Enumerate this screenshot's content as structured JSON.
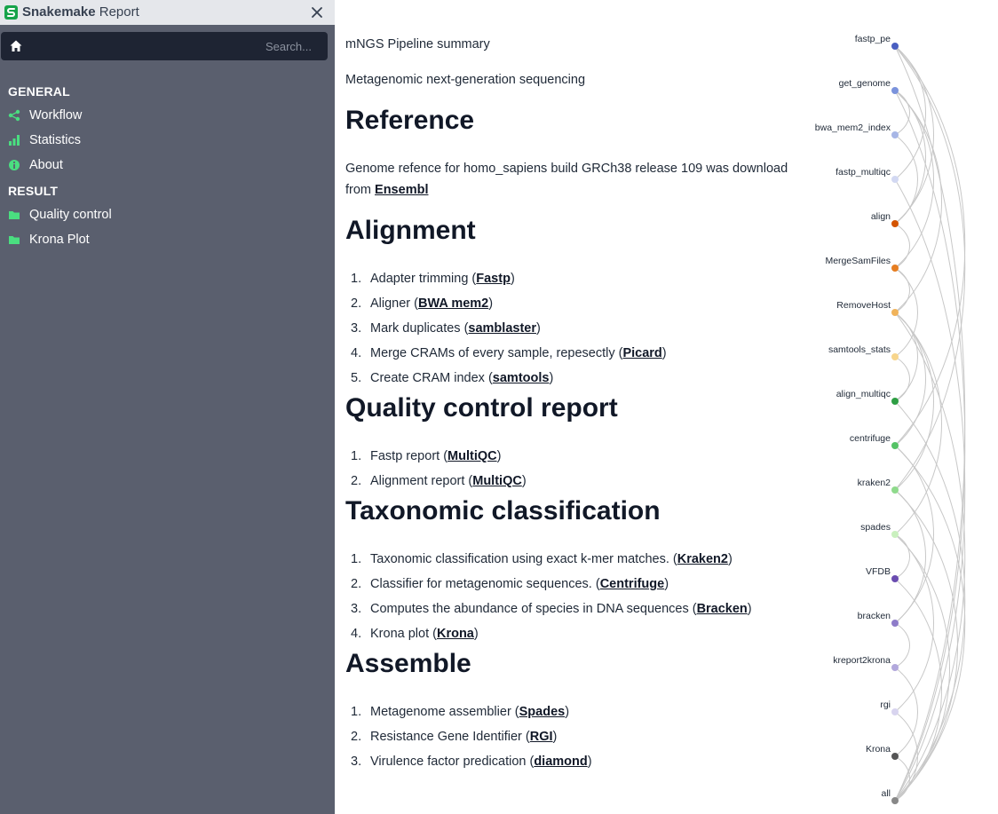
{
  "app": {
    "brand_bold": "Snakemake",
    "brand_rest": " Report"
  },
  "search": {
    "placeholder": "Search..."
  },
  "sidebar": {
    "general_heading": "GENERAL",
    "general_items": [
      {
        "label": "Workflow",
        "icon": "share-icon"
      },
      {
        "label": "Statistics",
        "icon": "bar-chart-icon"
      },
      {
        "label": "About",
        "icon": "info-icon"
      }
    ],
    "result_heading": "RESULT",
    "result_items": [
      {
        "label": "Quality control",
        "icon": "folder-icon"
      },
      {
        "label": "Krona Plot",
        "icon": "folder-icon"
      }
    ]
  },
  "main": {
    "summary": "mNGS Pipeline summary",
    "subtitle": "Metagenomic next-generation sequencing",
    "reference": {
      "heading": "Reference",
      "text_line1": "Genome refence for homo_sapiens build GRCh38 release 109 was download",
      "text_from": "from ",
      "link": "Ensembl"
    },
    "alignment": {
      "heading": "Alignment",
      "items": [
        {
          "num": "1.",
          "text": "Adapter trimming (",
          "link": "Fastp",
          "close": ")"
        },
        {
          "num": "2.",
          "text": "Aligner (",
          "link": "BWA mem2",
          "close": ")"
        },
        {
          "num": "3.",
          "text": "Mark duplicates (",
          "link": "samblaster",
          "close": ")"
        },
        {
          "num": "4.",
          "text": "Merge CRAMs of every sample, repesectly (",
          "link": "Picard",
          "close": ")"
        },
        {
          "num": "5.",
          "text": "Create CRAM index (",
          "link": "samtools",
          "close": ")"
        }
      ]
    },
    "qc": {
      "heading": "Quality control report",
      "items": [
        {
          "num": "1.",
          "text": "Fastp report (",
          "link": "MultiQC",
          "close": ")"
        },
        {
          "num": "2.",
          "text": "Alignment report (",
          "link": "MultiQC",
          "close": ")"
        }
      ]
    },
    "taxonomy": {
      "heading": "Taxonomic classification",
      "items": [
        {
          "num": "1.",
          "text": "Taxonomic classification using exact k-mer matches. (",
          "link": "Kraken2",
          "close": ")"
        },
        {
          "num": "2.",
          "text": "Classifier for metagenomic sequences. (",
          "link": "Centrifuge",
          "close": ")"
        },
        {
          "num": "3.",
          "text": "Computes the abundance of species in DNA sequences (",
          "link": "Bracken",
          "close": ")"
        },
        {
          "num": "4.",
          "text": "Krona plot (",
          "link": "Krona",
          "close": ")"
        }
      ]
    },
    "assemble": {
      "heading": "Assemble",
      "items": [
        {
          "num": "1.",
          "text": "Metagenome assemblier (",
          "link": "Spades",
          "close": ")"
        },
        {
          "num": "2.",
          "text": "Resistance Gene Identifier (",
          "link": "RGI",
          "close": ")"
        },
        {
          "num": "3.",
          "text": "Virulence factor predication (",
          "link": "diamond",
          "close": ")"
        }
      ]
    }
  },
  "dag": {
    "nodes": [
      {
        "name": "fastp_pe",
        "color": "#4a5fc1"
      },
      {
        "name": "get_genome",
        "color": "#7b93dc"
      },
      {
        "name": "bwa_mem2_index",
        "color": "#a7b6e6"
      },
      {
        "name": "fastp_multiqc",
        "color": "#d2d8f2"
      },
      {
        "name": "align",
        "color": "#d35400"
      },
      {
        "name": "MergeSamFiles",
        "color": "#e67e22"
      },
      {
        "name": "RemoveHost",
        "color": "#f0b35a"
      },
      {
        "name": "samtools_stats",
        "color": "#f7d58c"
      },
      {
        "name": "align_multiqc",
        "color": "#2e9e44"
      },
      {
        "name": "centrifuge",
        "color": "#55c266"
      },
      {
        "name": "kraken2",
        "color": "#8fda8c"
      },
      {
        "name": "spades",
        "color": "#c9f0be"
      },
      {
        "name": "VFDB",
        "color": "#6a4cb0"
      },
      {
        "name": "bracken",
        "color": "#8e7cc9"
      },
      {
        "name": "kreport2krona",
        "color": "#b2a8dc"
      },
      {
        "name": "rgi",
        "color": "#d8d4ef"
      },
      {
        "name": "Krona",
        "color": "#555555"
      },
      {
        "name": "all",
        "color": "#888888"
      }
    ]
  }
}
